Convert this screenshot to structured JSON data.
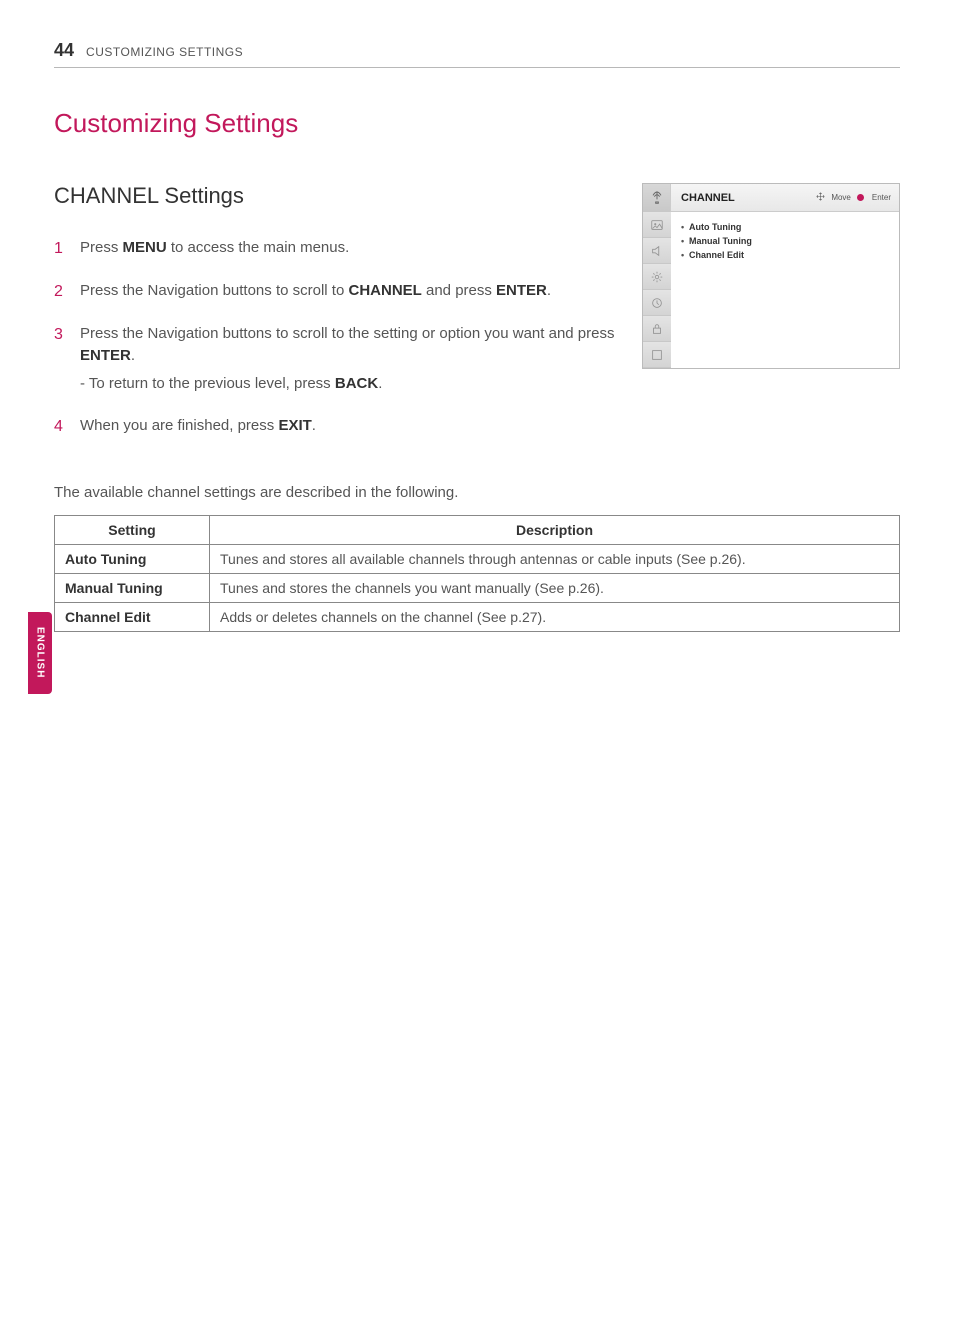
{
  "header": {
    "page_number": "44",
    "section_label": "CUSTOMIZING SETTINGS"
  },
  "main": {
    "title": "Customizing Settings",
    "section_title": "CHANNEL Settings",
    "steps": [
      {
        "num": "1",
        "text_before": "Press ",
        "bold1": "MENU",
        "text_after": " to access the main menus."
      },
      {
        "num": "2",
        "text_before": "Press the Navigation buttons to scroll to ",
        "bold1": "CHANNEL",
        "text_mid": " and press ",
        "bold2": "ENTER",
        "text_after": "."
      },
      {
        "num": "3",
        "text_before": "Press the Navigation buttons to scroll to the setting or option you want and press ",
        "bold1": "ENTER",
        "text_after": ".",
        "sub_before": "- To return to the previous level, press ",
        "sub_bold": "BACK",
        "sub_after": "."
      },
      {
        "num": "4",
        "text_before": "When you are finished, press ",
        "bold1": "EXIT",
        "text_after": "."
      }
    ],
    "table_intro": "The available channel settings are described in the following.",
    "table": {
      "col_setting": "Setting",
      "col_desc": "Description",
      "rows": [
        {
          "name": "Auto Tuning",
          "desc": "Tunes and stores all available channels through antennas or cable inputs (See p.26)."
        },
        {
          "name": "Manual Tuning",
          "desc": "Tunes and stores the channels you want manually (See p.26)."
        },
        {
          "name": "Channel Edit",
          "desc": "Adds or deletes channels on the channel (See p.27)."
        }
      ]
    }
  },
  "osd": {
    "title": "CHANNEL",
    "hint_move": "Move",
    "hint_enter": "Enter",
    "items": [
      "Auto Tuning",
      "Manual Tuning",
      "Channel Edit"
    ]
  },
  "lang_tab": "ENGLISH"
}
